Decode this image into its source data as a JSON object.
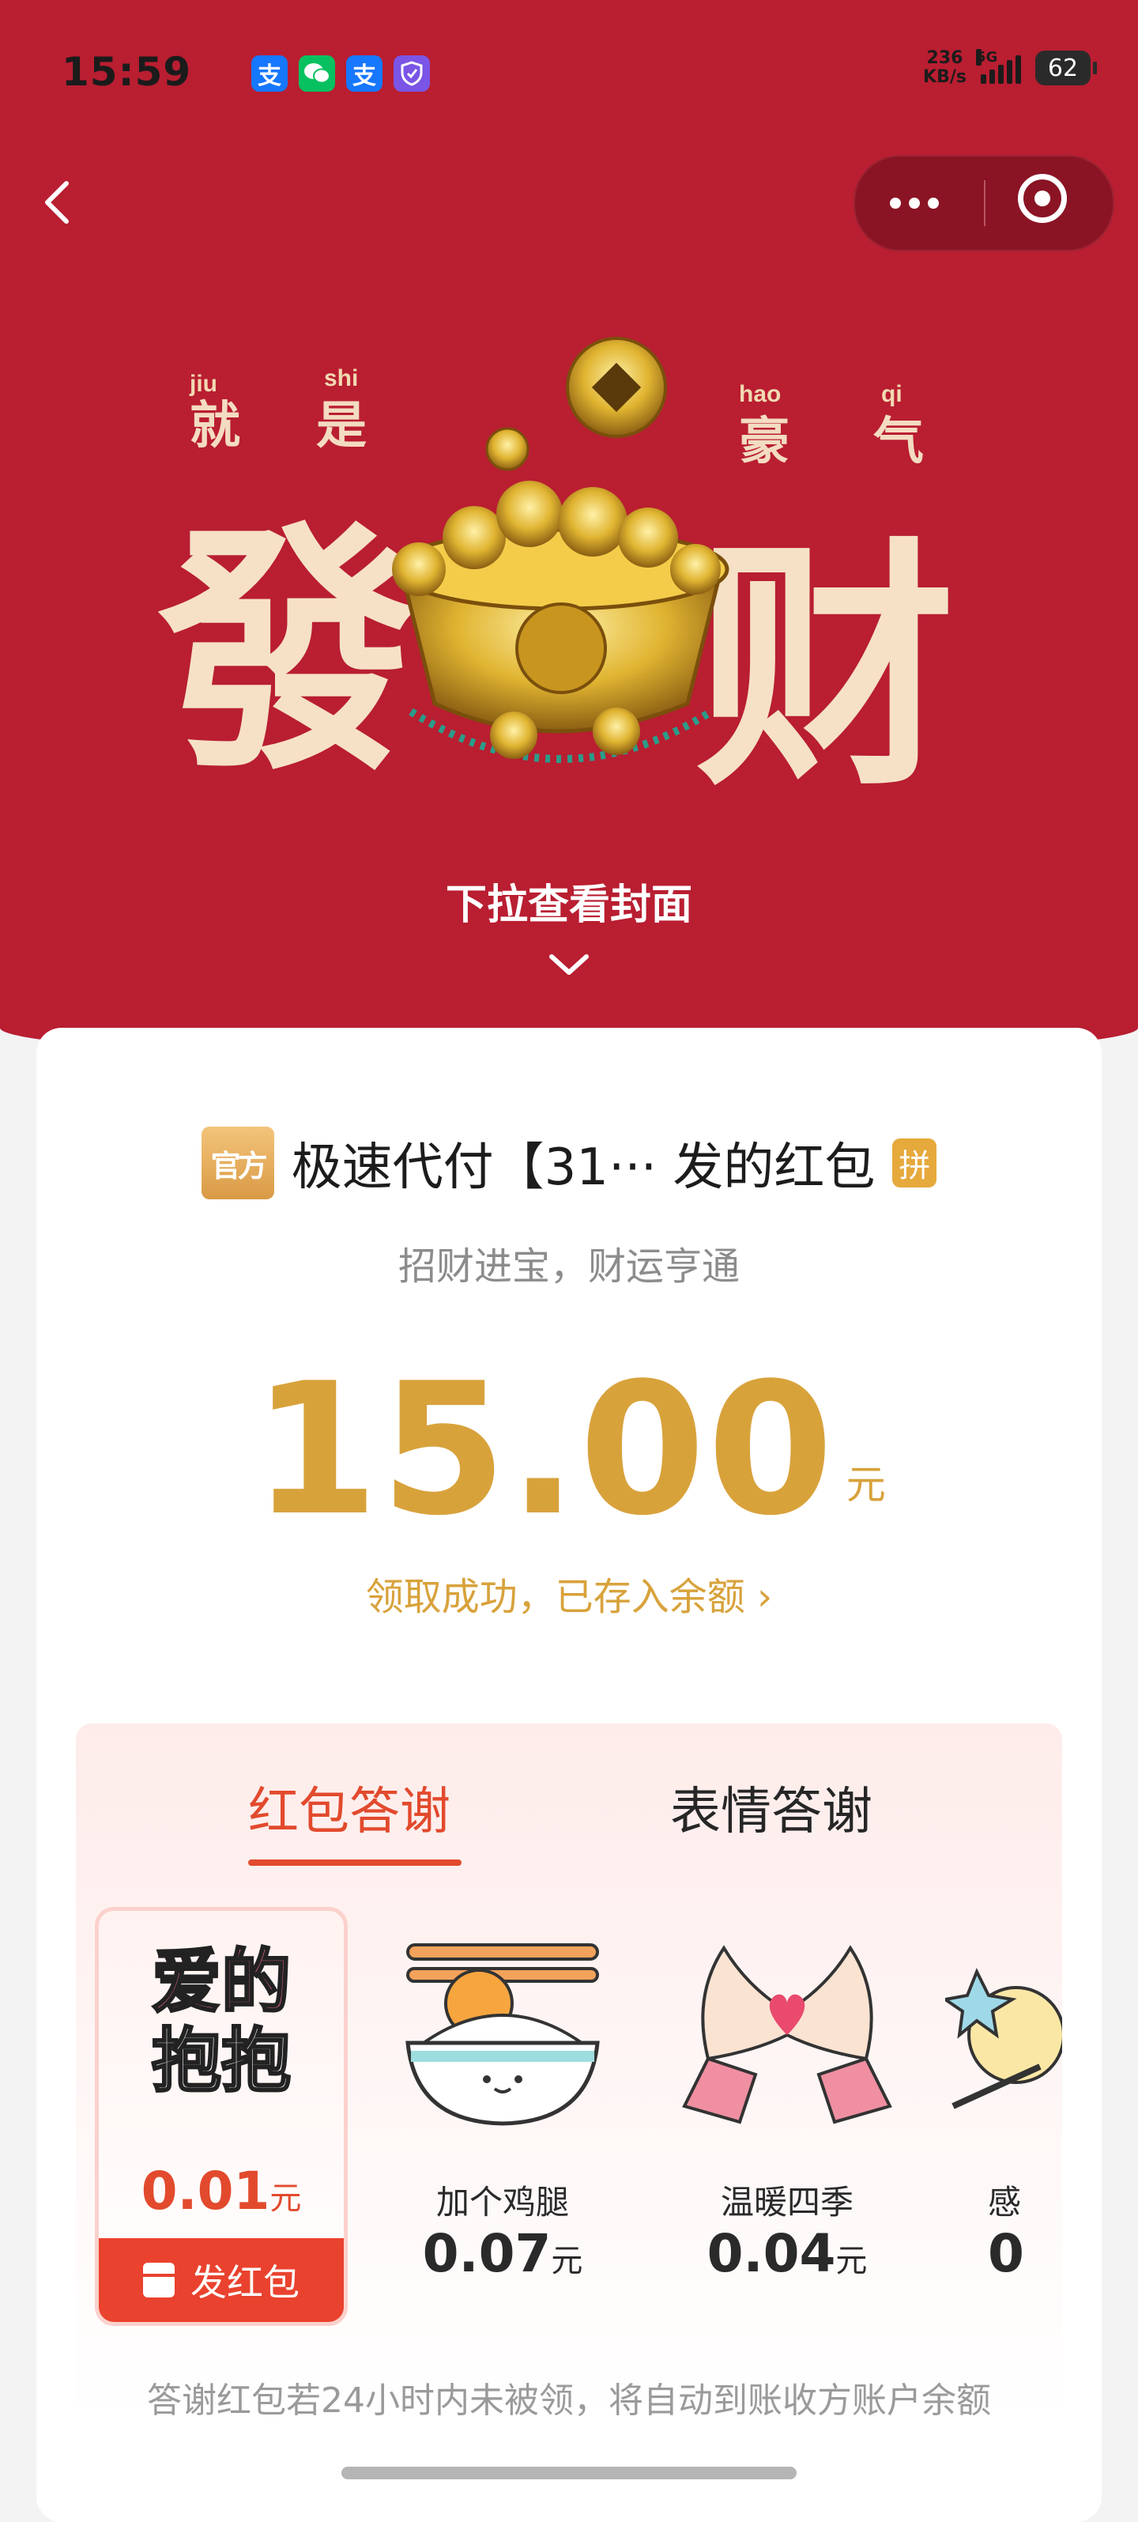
{
  "status_bar": {
    "time": "15:59",
    "net_speed": "236",
    "net_unit": "KB/s",
    "network": "5G",
    "battery": "62",
    "app_icons": [
      {
        "name": "alipay-icon",
        "glyph": "支",
        "color": "#1677ff"
      },
      {
        "name": "wechat-icon",
        "glyph": "✉",
        "color": "#07c160"
      },
      {
        "name": "alipay-icon-2",
        "glyph": "支",
        "color": "#1677ff"
      },
      {
        "name": "shield-icon",
        "glyph": "⛉",
        "color": "#7a55e6"
      }
    ]
  },
  "cover": {
    "pinyin": [
      "jiu",
      "shi",
      "hao",
      "qi"
    ],
    "small_chars": [
      "就",
      "是",
      "豪",
      "气"
    ],
    "big_chars": [
      "發",
      "财"
    ],
    "hint": "下拉查看封面"
  },
  "card": {
    "avatar_text": "官方",
    "sender": "极速代付【31··· 发的红包",
    "badge": "拼",
    "subtitle": "招财进宝，财运亨通",
    "amount": "15.00",
    "currency": "元",
    "received_link": "领取成功，已存入余额 ›"
  },
  "thanks": {
    "tabs": [
      {
        "label": "红包答谢",
        "active": true
      },
      {
        "label": "表情答谢",
        "active": false
      }
    ],
    "items": [
      {
        "name": "",
        "sticker_lines": [
          "爱的",
          "抱抱"
        ],
        "price": "0.01",
        "unit": "元",
        "selected": true
      },
      {
        "name": "加个鸡腿",
        "price": "0.07",
        "unit": "元",
        "selected": false
      },
      {
        "name": "温暖四季",
        "price": "0.04",
        "unit": "元",
        "selected": false
      },
      {
        "name": "感",
        "price": "0",
        "unit": "",
        "selected": false
      }
    ],
    "send_button": "发红包",
    "note": "答谢红包若24小时内未被领，将自动到账收方账户余额"
  },
  "colors": {
    "banner": "#b91e31",
    "gold": "#d8a23b",
    "accent_red": "#e24a2d"
  }
}
